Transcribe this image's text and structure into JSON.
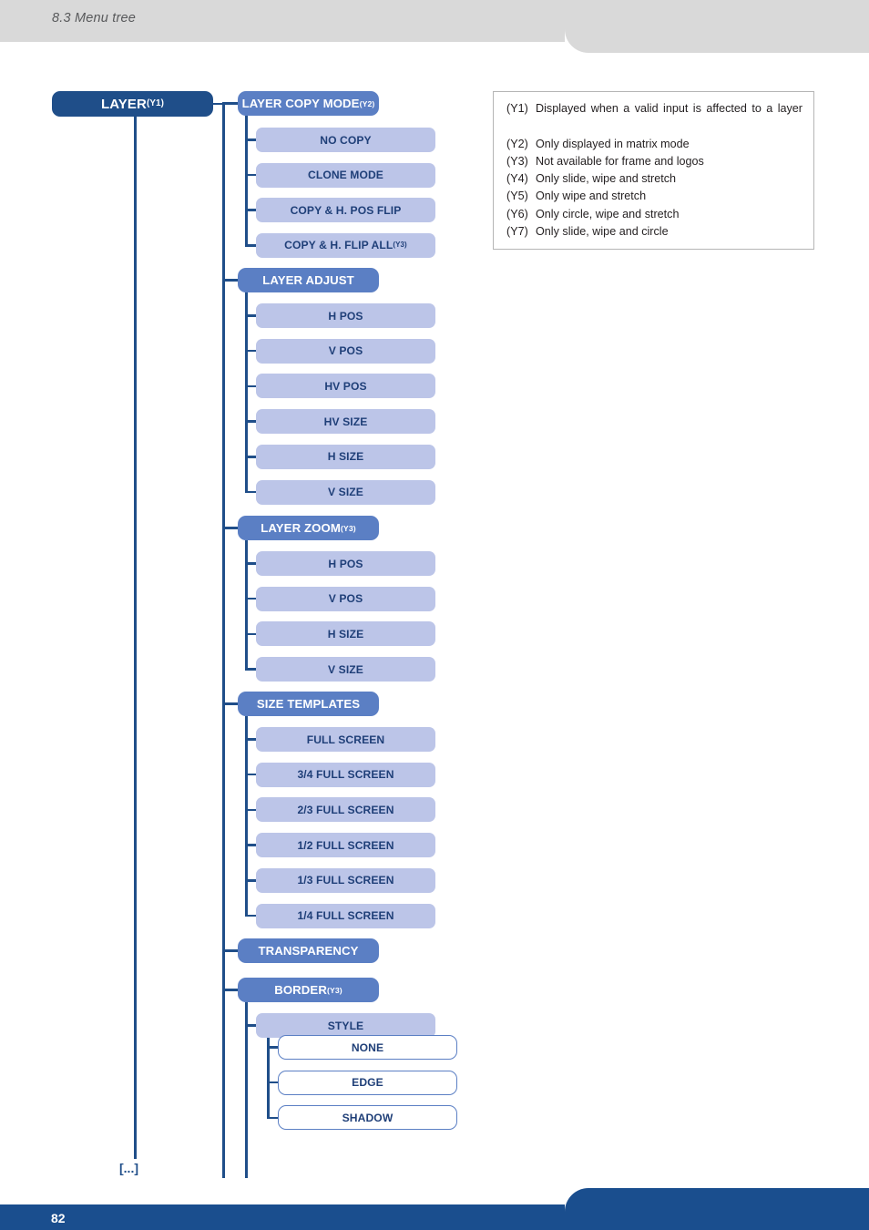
{
  "header": {
    "title": "8.3 Menu tree"
  },
  "footer": {
    "page_number": "82"
  },
  "colors": {
    "level1": "#1f4e89",
    "level2": "#5b7fc4",
    "level3": "#bcc5e8",
    "level4_border": "#5b7fc4",
    "header_bg": "#d9d9d9",
    "footer_bg": "#1a4e8e",
    "connector": "#1f4e89"
  },
  "legend": {
    "rows": [
      {
        "tag": "(Y1)",
        "text": "Displayed when a valid input is affected to a layer",
        "justify": true
      },
      {
        "tag": "(Y2)",
        "text": "Only displayed in matrix mode",
        "justify": false
      },
      {
        "tag": "(Y3)",
        "text": "Not available for frame and logos",
        "justify": false
      },
      {
        "tag": "(Y4)",
        "text": "Only slide, wipe and stretch",
        "justify": false
      },
      {
        "tag": "(Y5)",
        "text": "Only wipe and stretch",
        "justify": false
      },
      {
        "tag": "(Y6)",
        "text": "Only circle, wipe and stretch",
        "justify": false
      },
      {
        "tag": "(Y7)",
        "text": "Only slide, wipe and circle",
        "justify": false
      }
    ]
  },
  "tree": {
    "root": {
      "label": "LAYER",
      "sup": "(Y1)"
    },
    "continuation": "[...]",
    "branches": [
      {
        "label": "LAYER COPY MODE",
        "sup": "(Y2)",
        "children": [
          {
            "label": "NO COPY",
            "sup": ""
          },
          {
            "label": "CLONE MODE",
            "sup": ""
          },
          {
            "label": "COPY & H. POS FLIP",
            "sup": ""
          },
          {
            "label": "COPY & H. FLIP ALL",
            "sup": "(Y3)"
          }
        ]
      },
      {
        "label": "LAYER ADJUST",
        "sup": "",
        "children": [
          {
            "label": "H POS",
            "sup": ""
          },
          {
            "label": "V POS",
            "sup": ""
          },
          {
            "label": "HV POS",
            "sup": ""
          },
          {
            "label": "HV SIZE",
            "sup": ""
          },
          {
            "label": "H SIZE",
            "sup": ""
          },
          {
            "label": "V SIZE",
            "sup": ""
          }
        ]
      },
      {
        "label": "LAYER ZOOM",
        "sup": "(Y3)",
        "children": [
          {
            "label": "H POS",
            "sup": ""
          },
          {
            "label": "V POS",
            "sup": ""
          },
          {
            "label": "H SIZE",
            "sup": ""
          },
          {
            "label": "V SIZE",
            "sup": ""
          }
        ]
      },
      {
        "label": "SIZE TEMPLATES",
        "sup": "",
        "children": [
          {
            "label": "FULL SCREEN",
            "sup": ""
          },
          {
            "label": "3/4 FULL SCREEN",
            "sup": ""
          },
          {
            "label": "2/3 FULL SCREEN",
            "sup": ""
          },
          {
            "label": "1/2 FULL SCREEN",
            "sup": ""
          },
          {
            "label": "1/3 FULL SCREEN",
            "sup": ""
          },
          {
            "label": "1/4 FULL SCREEN",
            "sup": ""
          }
        ]
      },
      {
        "label": "TRANSPARENCY",
        "sup": "",
        "children": []
      },
      {
        "label": "BORDER",
        "sup": "(Y3)",
        "children": [
          {
            "label": "STYLE",
            "sup": "",
            "children": [
              {
                "label": "NONE",
                "sup": ""
              },
              {
                "label": "EDGE",
                "sup": ""
              },
              {
                "label": "SHADOW",
                "sup": ""
              }
            ]
          }
        ]
      }
    ]
  }
}
